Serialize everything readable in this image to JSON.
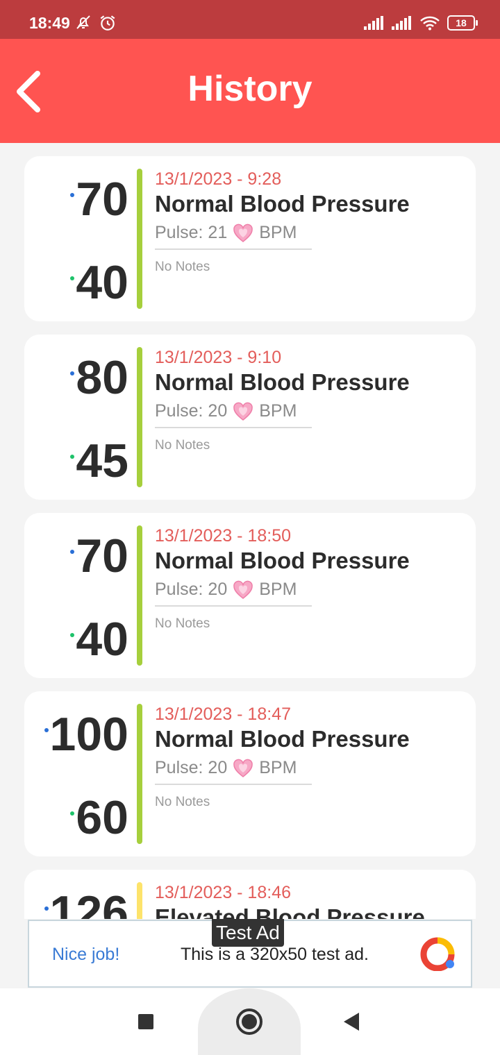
{
  "status_bar": {
    "time": "18:49",
    "battery": "18"
  },
  "header": {
    "title": "History"
  },
  "colors": {
    "accent": "#ff5451",
    "normal_bar": "#a6cf3c",
    "elevated_bar": "#fde36b",
    "systolic_dot": "#2a6fd6",
    "diastolic_dot": "#1ec26a",
    "date_text": "#e35d5a"
  },
  "records": [
    {
      "systolic": "70",
      "diastolic": "40",
      "date": "13/1/2023 - 9:28",
      "category": "Normal Blood Pressure",
      "pulse_prefix": "Pulse: 21",
      "pulse_unit": "BPM",
      "notes": "No Notes",
      "status": "normal"
    },
    {
      "systolic": "80",
      "diastolic": "45",
      "date": "13/1/2023 - 9:10",
      "category": "Normal Blood Pressure",
      "pulse_prefix": "Pulse: 20",
      "pulse_unit": "BPM",
      "notes": "No Notes",
      "status": "normal"
    },
    {
      "systolic": "70",
      "diastolic": "40",
      "date": "13/1/2023 - 18:50",
      "category": "Normal Blood Pressure",
      "pulse_prefix": "Pulse: 20",
      "pulse_unit": "BPM",
      "notes": "No Notes",
      "status": "normal"
    },
    {
      "systolic": "100",
      "diastolic": "60",
      "date": "13/1/2023 - 18:47",
      "category": "Normal Blood Pressure",
      "pulse_prefix": "Pulse: 20",
      "pulse_unit": "BPM",
      "notes": "No Notes",
      "status": "normal"
    },
    {
      "systolic": "126",
      "diastolic": "",
      "date": "13/1/2023 - 18:46",
      "category": "Elevated Blood Pressure",
      "pulse_prefix": "",
      "pulse_unit": "",
      "notes": "",
      "status": "elevated"
    }
  ],
  "ad": {
    "label": "Test Ad",
    "nice": "Nice job!",
    "text": "This is a 320x50 test ad."
  },
  "icons": {
    "back": "chevron-left-icon",
    "heart": "heart-icon",
    "mute": "bell-off-icon",
    "alarm": "alarm-icon",
    "signal": "signal-icon",
    "wifi": "wifi-icon"
  }
}
